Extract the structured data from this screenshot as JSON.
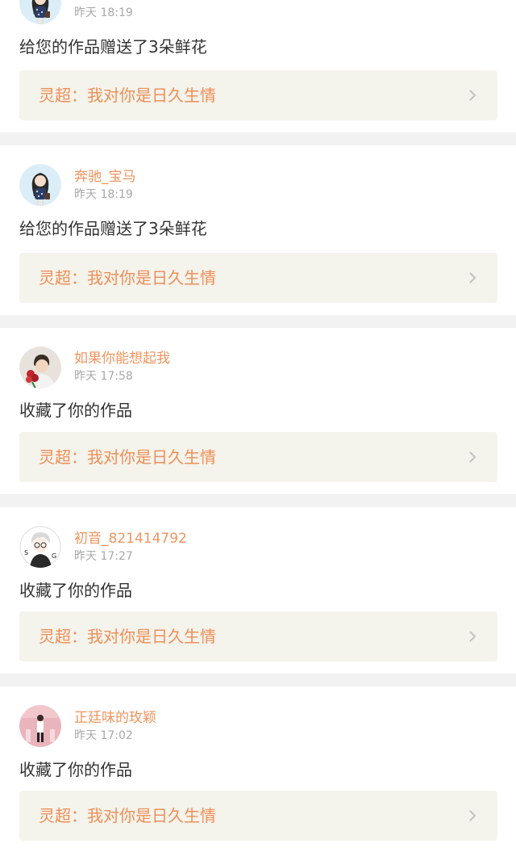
{
  "notifications": [
    {
      "username": "",
      "time": "昨天 18:19",
      "action": "给您的作品赠送了3朵鲜花",
      "work": "灵超：我对你是日久生情",
      "avatar": "girl-avatar-icon"
    },
    {
      "username": "奔驰_宝马",
      "time": "昨天 18:19",
      "action": "给您的作品赠送了3朵鲜花",
      "work": "灵超：我对你是日久生情",
      "avatar": "girl-avatar-icon"
    },
    {
      "username": "如果你能想起我",
      "time": "昨天 17:58",
      "action": "收藏了你的作品",
      "work": "灵超：我对你是日久生情",
      "avatar": "boy-with-roses-avatar-icon"
    },
    {
      "username": "初音_821414792",
      "time": "昨天 17:27",
      "action": "收藏了你的作品",
      "work": "灵超：我对你是日久生情",
      "avatar": "anime-boy-avatar-icon"
    },
    {
      "username": "正廷味的玫颖",
      "time": "昨天 17:02",
      "action": "收藏了你的作品",
      "work": "灵超：我对你是日久生情",
      "avatar": "pink-room-avatar-icon"
    }
  ],
  "colors": {
    "accent": "#f0955f",
    "link_bg": "#f4f3ec",
    "page_bg": "#f2f2f2",
    "timestamp": "#a8a8a8",
    "body_text": "#333333"
  }
}
